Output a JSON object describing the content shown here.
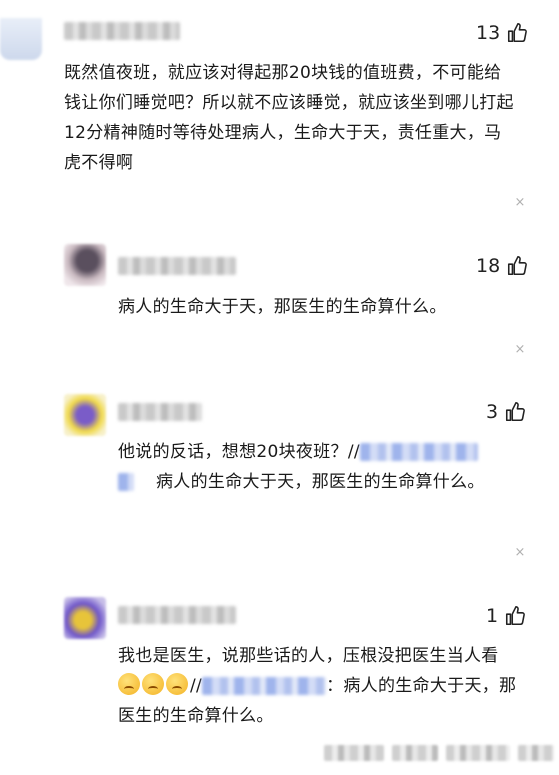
{
  "comments": [
    {
      "likes": "13",
      "text": "既然值夜班，就应该对得起那20块钱的值班费，不可能给钱让你们睡觉吧？所以就不应该睡觉，就应该坐到哪儿打起12分精神随时等待处理病人，生命大于天，责任重大，马虎不得啊"
    },
    {
      "likes": "18",
      "text": "病人的生命大于天，那医生的生命算什么。"
    },
    {
      "likes": "3",
      "text_prefix": "他说的反话，想想20块夜班？//",
      "text_quote": "病人的生命大于天，那医生的生命算什么。"
    },
    {
      "likes": "1",
      "text_prefix": "我也是医生，说那些话的人，压根没把医生当人看",
      "text_mid": "//",
      "text_quote": "：病人的生命大于天，那医生的生命算什么。"
    }
  ],
  "icons": {
    "like": "thumbs-up-icon",
    "dismiss": "close-icon",
    "emoji": "pleading-face-emoji"
  },
  "close_glyph": "×"
}
